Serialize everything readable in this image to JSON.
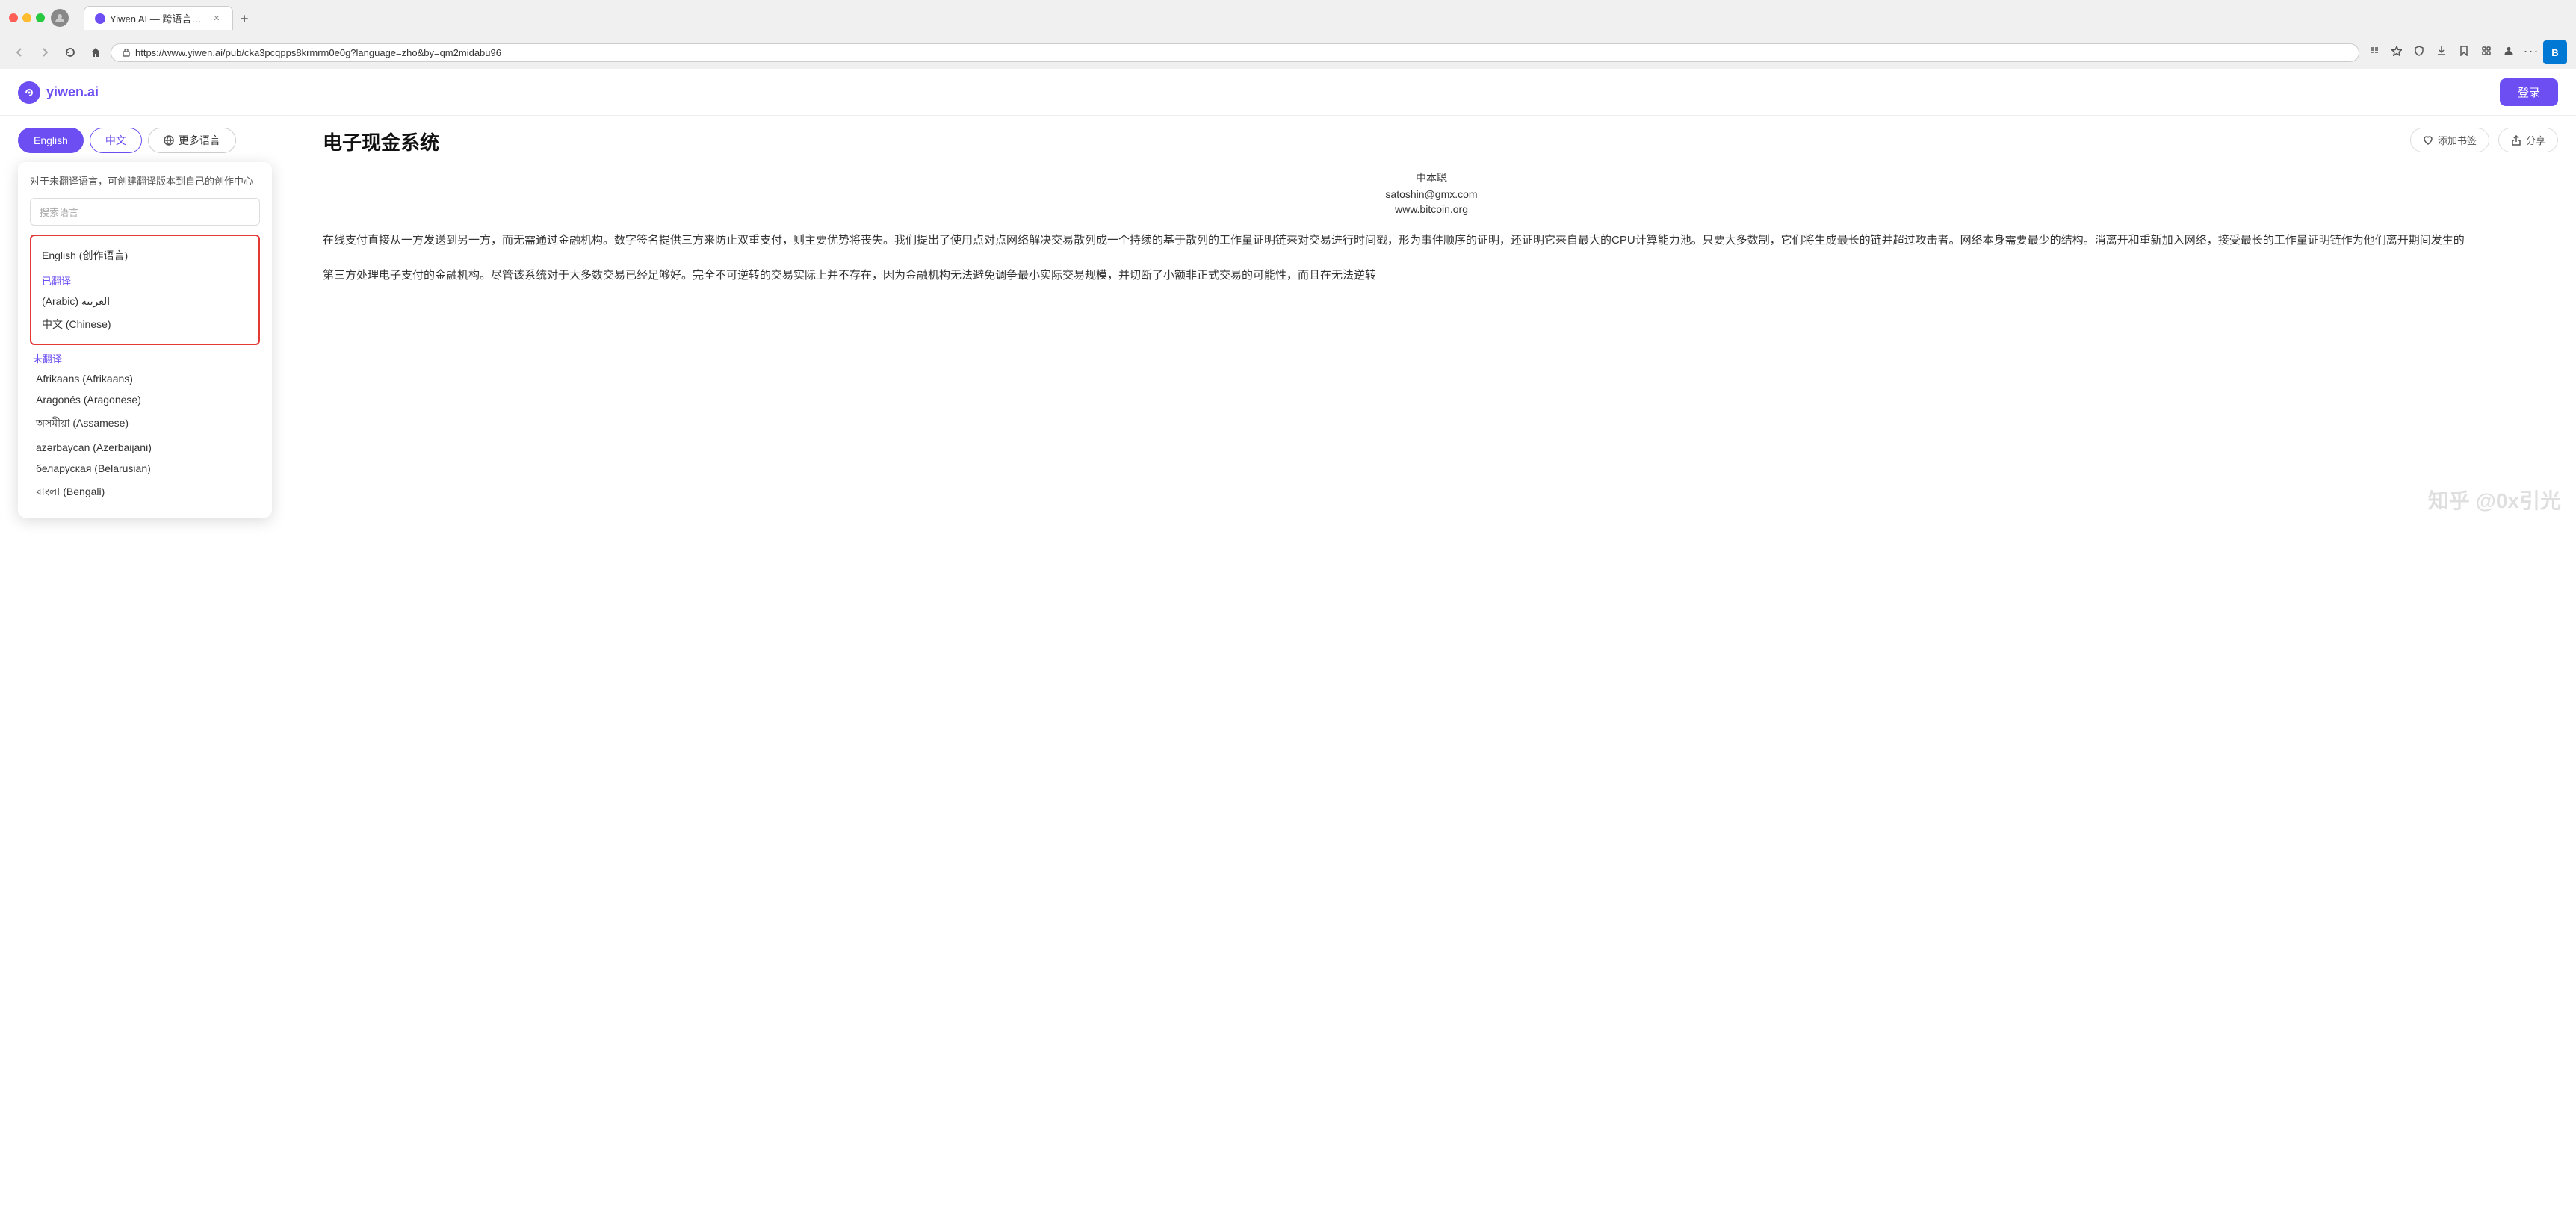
{
  "browser": {
    "tab_title": "Yiwen AI — 跨语言的知识网络",
    "url": "https://www.yiwen.ai/pub/cka3pcqpps8krmrm0e0g?language=zho&by=qm2midabu96",
    "back_btn": "←",
    "forward_btn": "→",
    "refresh_btn": "↺",
    "home_btn": "⌂",
    "login_btn": "登录"
  },
  "header": {
    "logo_text": "yiwen.ai",
    "login_btn": "登录"
  },
  "language_tabs": {
    "english_label": "English",
    "chinese_label": "中文",
    "more_label": "更多语言"
  },
  "dropdown": {
    "info_text": "对于未翻译语言，可创建翻译版本到自己的创作中心",
    "search_placeholder": "搜索语言",
    "source_language": "English (创作语言)",
    "translated_section_label": "已翻译",
    "arabic_label": "(Arabic) العربية",
    "chinese_label": "中文 (Chinese)",
    "untranslated_section_label": "未翻译",
    "languages": [
      "Afrikaans (Afrikaans)",
      "Aragonés (Aragonese)",
      "অসমীয়া (Assamese)",
      "azərbaycan (Azerbaijani)",
      "беларуская (Belarusian)",
      "বাংলা (Bengali)"
    ]
  },
  "action_bar": {
    "bookmark_label": "添加书签",
    "share_label": "分享"
  },
  "article": {
    "title": "电子现金系统",
    "author": "中本聪",
    "email": "satoshin@gmx.com",
    "website": "www.bitcoin.org",
    "paragraph1": "在线支付直接从一方发送到另一方，而无需通过金融机构。数字签名提供三方来防止双重支付，则主要优势将丧失。我们提出了使用点对点网络解决交易散列成一个持续的基于散列的工作量证明链来对交易进行时间戳，形为事件顺序的证明，还证明它来自最大的CPU计算能力池。只要大多数制，它们将生成最长的链并超过攻击者。网络本身需要最少的结构。消离开和重新加入网络，接受最长的工作量证明链作为他们离开期间发生的",
    "paragraph2": "第三方处理电子支付的金融机构。尽管该系统对于大多数交易已经足够好。完全不可逆转的交易实际上并不存在，因为金融机构无法避免调争最小实际交易规模，并切断了小额非正式交易的可能性，而且在无法逆转"
  },
  "watermark": "知乎 @0x引光"
}
